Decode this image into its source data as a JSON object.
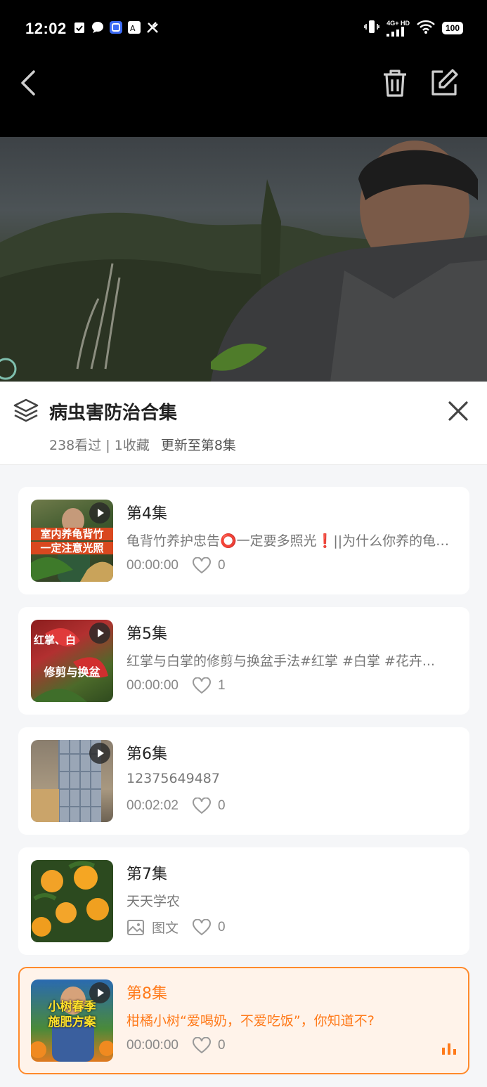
{
  "status_bar": {
    "time": "12:02",
    "network": "4G+ HD",
    "battery": "100",
    "icons": [
      "clipboard-check-icon",
      "chat-bubble-icon",
      "app-badge-icon",
      "translate-icon",
      "tools-icon"
    ]
  },
  "top_bar": {
    "icons": [
      "back-arrow-icon",
      "trash-icon",
      "edit-icon"
    ]
  },
  "collection": {
    "title": "病虫害防治合集",
    "stats": "238看过 | 1收藏",
    "update": "更新至第8集"
  },
  "episodes": [
    {
      "title": "第4集",
      "desc": "龟背竹养护忠告⭕一定要多照光❗||为什么你养的龟背竹...",
      "duration": "00:00:00",
      "likes": "0",
      "type": "video",
      "thumb_text": [
        "室内养龟背竹",
        "一定注意光照"
      ]
    },
    {
      "title": "第5集",
      "desc": "红掌与白掌的修剪与换盆手法#红掌 #白掌 #花卉...",
      "duration": "00:00:00",
      "likes": "1",
      "type": "video",
      "thumb_text": [
        "红掌、白",
        "修剪与换盆"
      ]
    },
    {
      "title": "第6集",
      "desc": "12375649487",
      "duration": "00:02:02",
      "likes": "0",
      "type": "video",
      "thumb_text": []
    },
    {
      "title": "第7集",
      "desc": "天天学农",
      "duration": "图文",
      "likes": "0",
      "type": "image-text",
      "thumb_text": []
    },
    {
      "title": "第8集",
      "desc": "柑橘小树“爱喝奶，不爱吃饭”，你知道不?",
      "duration": "00:00:00",
      "likes": "0",
      "type": "video",
      "active": true,
      "thumb_text": [
        "小树春季",
        "施肥方案"
      ]
    }
  ],
  "colors": {
    "accent": "#ff7a1a",
    "active_bg": "#fff3ea",
    "page_bg": "#f5f6f8"
  }
}
